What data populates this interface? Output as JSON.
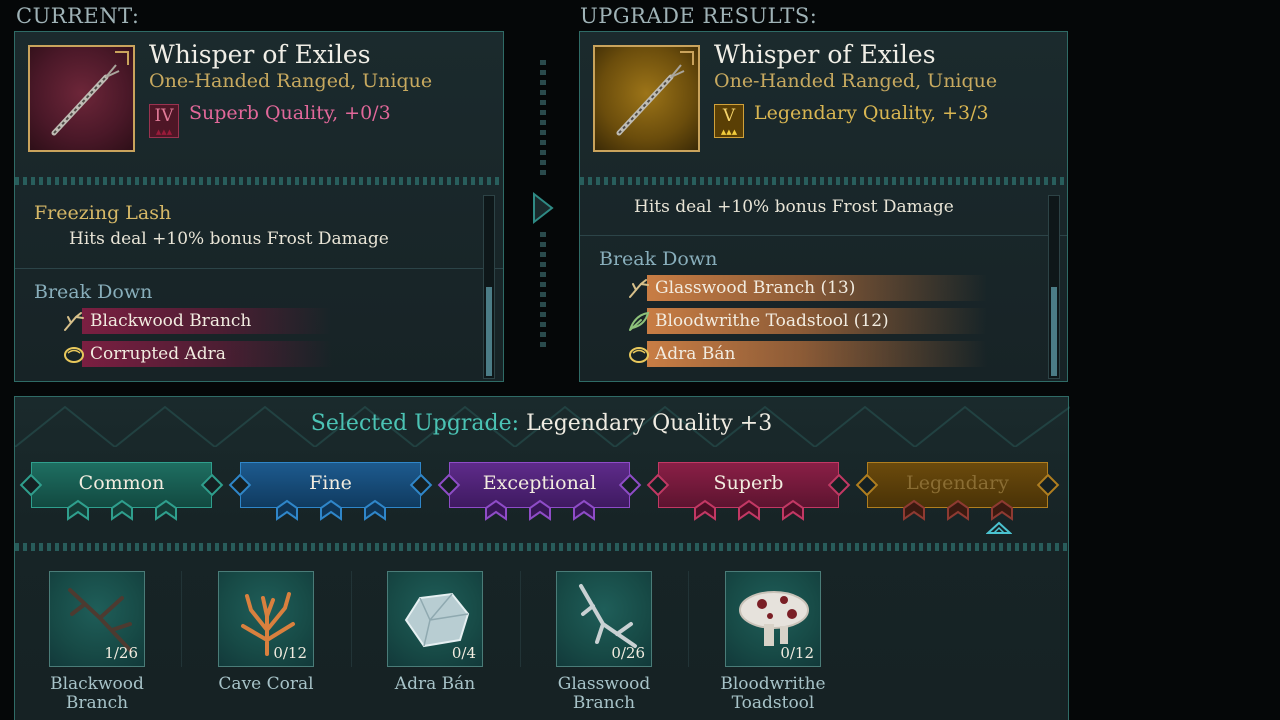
{
  "current": {
    "section_label": "CURRENT:",
    "item_name": "Whisper of Exiles",
    "item_type": "One-Handed Ranged, Unique",
    "quality_numeral": "IV",
    "quality_text": "Superb Quality, +0/3",
    "enchantment_name": "Freezing Lash",
    "enchantment_effect": "Hits deal +10% bonus Frost Damage",
    "break_down_label": "Break Down",
    "break_down": [
      {
        "icon": "branch-icon",
        "name": "Blackwood Branch"
      },
      {
        "icon": "ore-icon",
        "name": "Corrupted Adra"
      }
    ],
    "scroll_fraction": 0.3
  },
  "upgrade_results": {
    "section_label": "UPGRADE RESULTS:",
    "item_name": "Whisper of Exiles",
    "item_type": "One-Handed Ranged, Unique",
    "quality_numeral": "V",
    "quality_text": "Legendary Quality, +3/3",
    "enchantment_effect": "Hits deal +10% bonus Frost Damage",
    "break_down_label": "Break Down",
    "break_down": [
      {
        "icon": "branch-icon",
        "name": "Glasswood Branch (13)"
      },
      {
        "icon": "leaf-icon",
        "name": "Bloodwrithe Toadstool (12)"
      },
      {
        "icon": "ore-icon",
        "name": "Adra Bán"
      }
    ],
    "scroll_fraction": 0.3
  },
  "selected_upgrade": {
    "label": "Selected Upgrade:",
    "value": "Legendary Quality +3"
  },
  "tiers": [
    {
      "key": "common",
      "label": "Common",
      "color": "#2f9f8d"
    },
    {
      "key": "fine",
      "label": "Fine",
      "color": "#2f86c9"
    },
    {
      "key": "exceptional",
      "label": "Exceptional",
      "color": "#8e4cc7"
    },
    {
      "key": "superb",
      "label": "Superb",
      "color": "#c23864"
    },
    {
      "key": "legendary",
      "label": "Legendary",
      "color": "#b07e1f"
    }
  ],
  "materials": [
    {
      "name": "Blackwood Branch",
      "count": "1/26",
      "icon": "branch-icon"
    },
    {
      "name": "Cave Coral",
      "count": "0/12",
      "icon": "coral-icon"
    },
    {
      "name": "Adra Bán",
      "count": "0/4",
      "icon": "crystal-icon"
    },
    {
      "name": "Glasswood Branch",
      "count": "0/26",
      "icon": "branch-icon"
    },
    {
      "name": "Bloodwrithe Toadstool",
      "count": "0/12",
      "icon": "mushroom-icon"
    }
  ]
}
